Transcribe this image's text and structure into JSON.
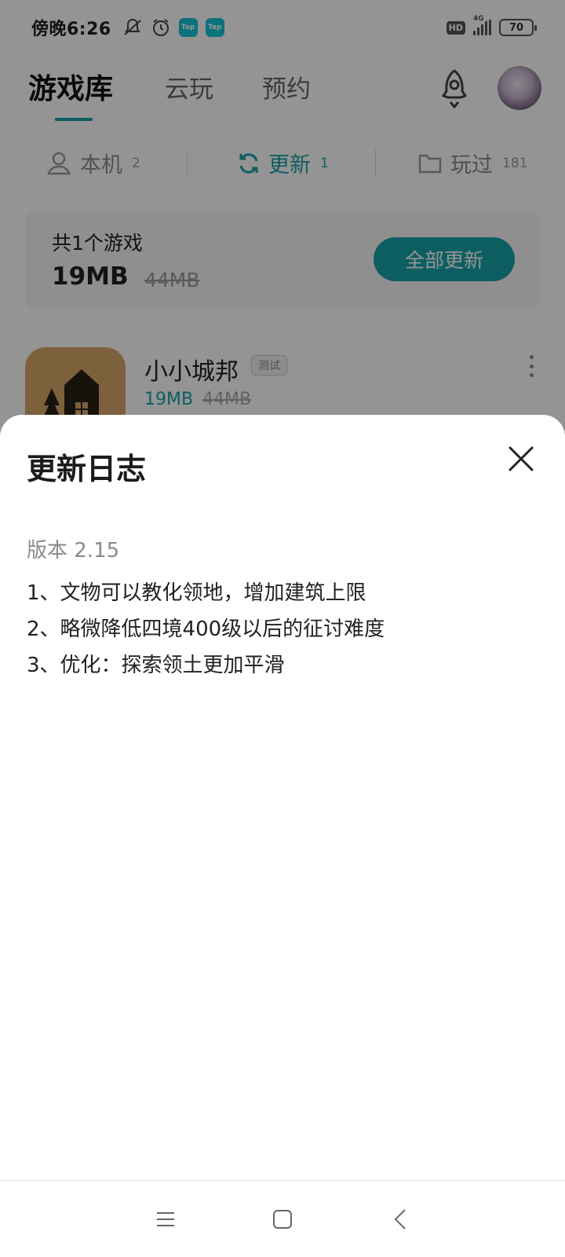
{
  "status_bar": {
    "time": "傍晚6:26",
    "badges": [
      "Tap",
      "Tap"
    ],
    "hd": "HD",
    "network": "4G",
    "battery": "70",
    "icons": [
      "mute-icon",
      "alarm-icon",
      "tap-app-icon",
      "tap-app-icon",
      "hd-icon",
      "signal-icon",
      "battery-icon"
    ]
  },
  "top_nav": {
    "tabs": [
      {
        "label": "游戏库",
        "active": true
      },
      {
        "label": "云玩",
        "active": false
      },
      {
        "label": "预约",
        "active": false
      }
    ],
    "icons": [
      "rocket-icon",
      "avatar"
    ]
  },
  "sub_tabs": [
    {
      "label": "本机",
      "count": "2",
      "icon": "person-icon",
      "active": false
    },
    {
      "label": "更新",
      "count": "1",
      "icon": "refresh-icon",
      "active": true
    },
    {
      "label": "玩过",
      "count": "181",
      "icon": "folder-icon",
      "active": false
    }
  ],
  "summary": {
    "count_text": "共1个游戏",
    "size": "19MB",
    "original_size": "44MB",
    "update_all_label": "全部更新"
  },
  "game": {
    "name": "小小城邦",
    "badge": "测试",
    "size": "19MB",
    "original_size": "44MB",
    "icon": "house-game-icon"
  },
  "sheet": {
    "title": "更新日志",
    "version": "版本 2.15",
    "changes": [
      "1、文物可以教化领地，增加建筑上限",
      "2、略微降低四境400级以后的征讨难度",
      "3、优化：探索领土更加平滑"
    ]
  },
  "nav_bar": {
    "buttons": [
      "menu-icon",
      "home-icon",
      "back-icon"
    ]
  },
  "colors": {
    "accent": "#17a3a8",
    "overlay": "rgba(0,0,0,0.42)"
  }
}
